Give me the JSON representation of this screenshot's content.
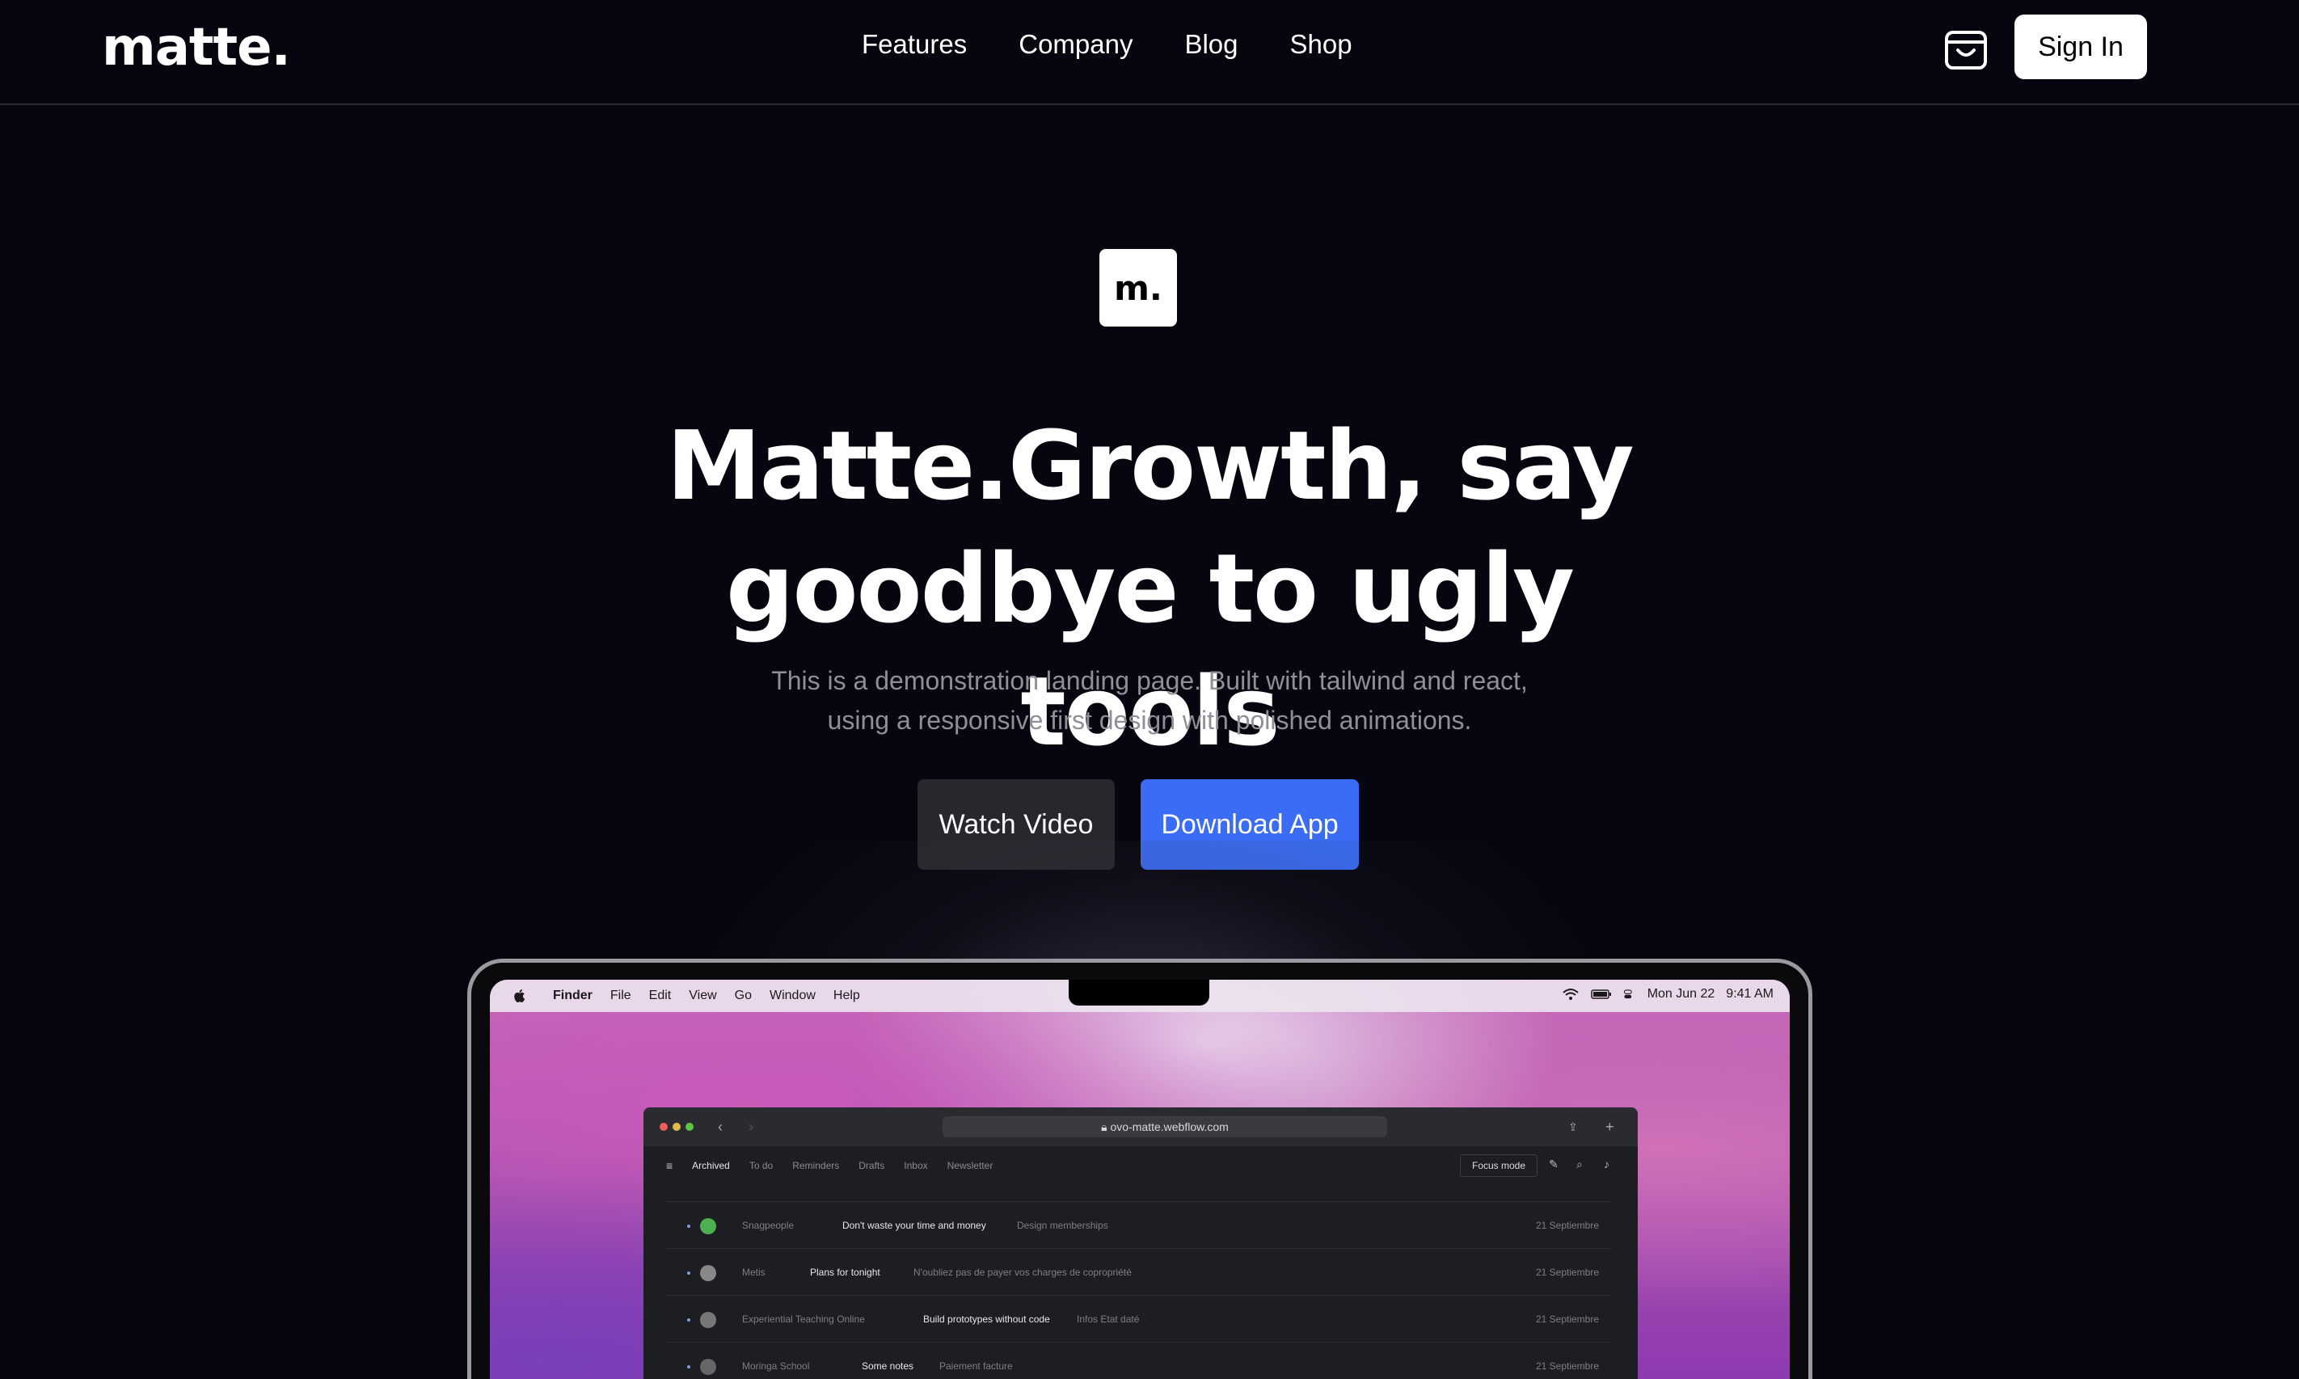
{
  "brand": {
    "logo": "matte.",
    "badge": "m."
  },
  "nav": {
    "links": [
      "Features",
      "Company",
      "Blog",
      "Shop"
    ],
    "signin_label": "Sign In"
  },
  "hero": {
    "headline_line1": "Matte.Growth, say",
    "headline_line2": "goodbye to ugly tools",
    "subtitle": "This is a demonstration landing page. Built with tailwind and react, using a responsive first design with polished animations.",
    "watch_label": "Watch Video",
    "download_label": "Download App"
  },
  "colors": {
    "background": "#05060f",
    "accent": "#3b6cf5",
    "secondary_button": "#27282d"
  },
  "mac": {
    "menu": [
      "Finder",
      "File",
      "Edit",
      "View",
      "Go",
      "Window",
      "Help"
    ],
    "date": "Mon Jun 22",
    "time": "9:41 AM"
  },
  "browser": {
    "url": "ovo-matte.webflow.com",
    "tabs": [
      "Archived",
      "To do",
      "Reminders",
      "Drafts",
      "Inbox",
      "Newsletter"
    ],
    "focus_label": "Focus mode",
    "rows": [
      {
        "sender": "Snagpeople",
        "subject": "Don't waste your time and money",
        "preview": "Design memberships",
        "date": "21 Septiembre"
      },
      {
        "sender": "Metis",
        "subject": "Plans for tonight",
        "preview": "N'oubliez pas de payer vos charges de copropriété",
        "date": "21 Septiembre"
      },
      {
        "sender": "Experiential Teaching Online",
        "subject": "Build prototypes without code",
        "preview": "Infos Etat daté",
        "date": "21 Septiembre"
      },
      {
        "sender": "Moringa School",
        "subject": "Some notes",
        "preview": "Paiement facture",
        "date": "21 Septiembre"
      }
    ]
  }
}
